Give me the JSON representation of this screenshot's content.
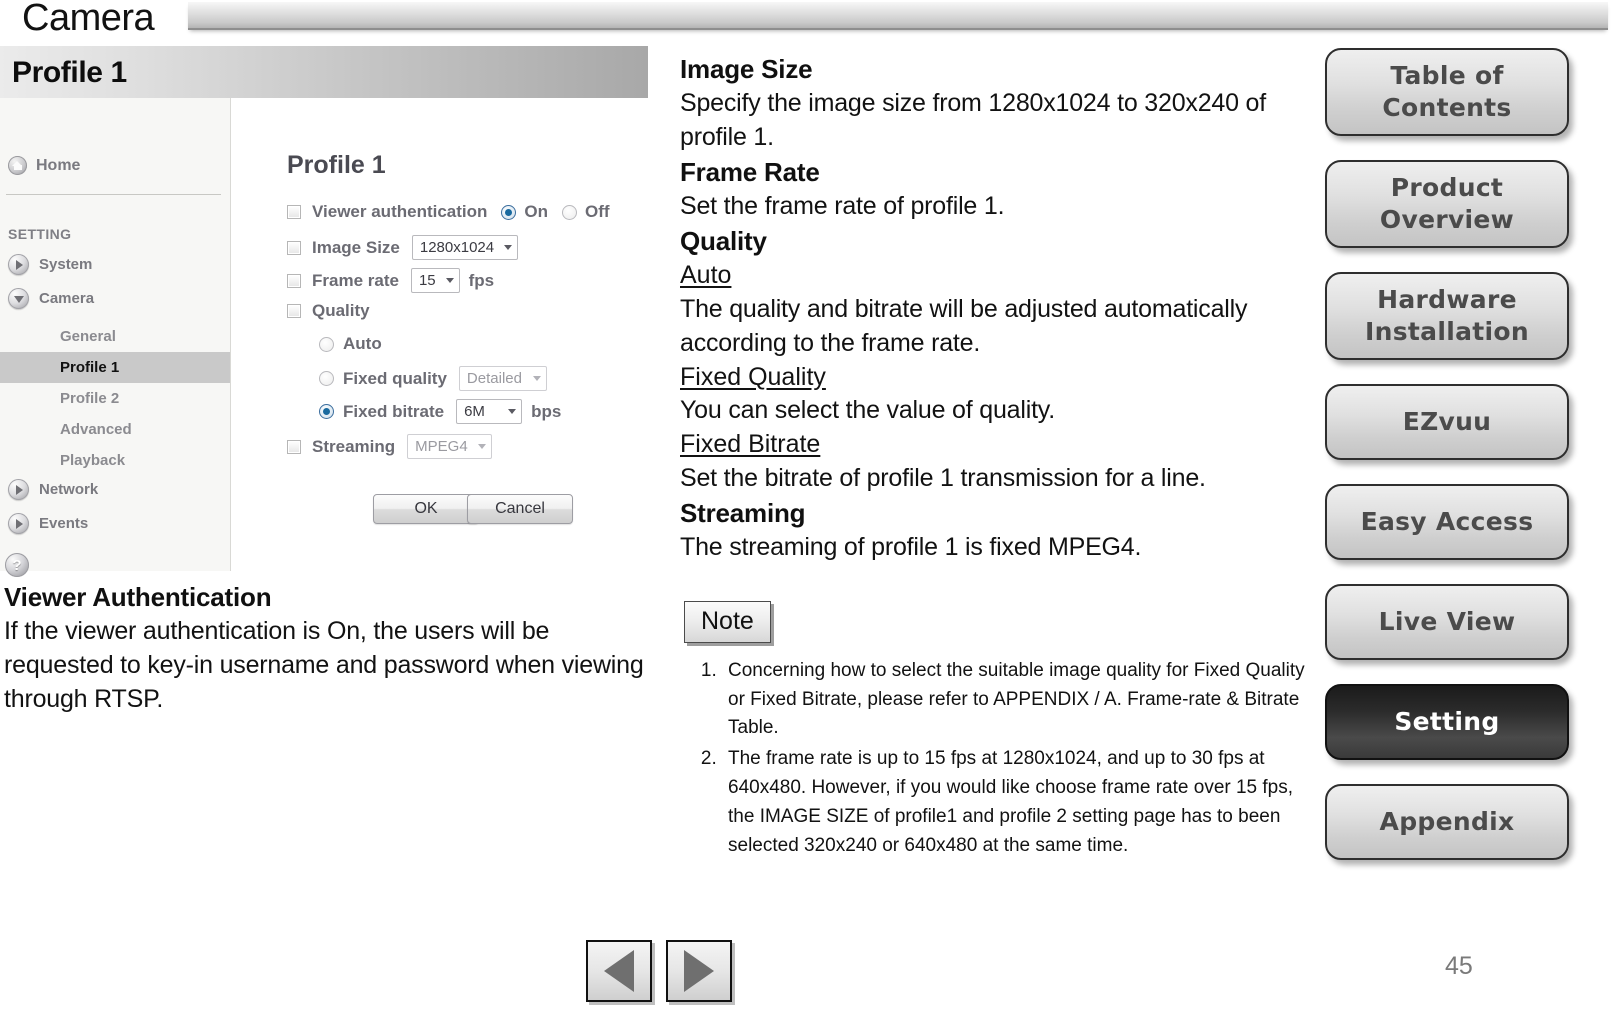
{
  "header": {
    "title": "Camera"
  },
  "camera_ui": {
    "titlebar": "Profile 1",
    "sidebar": {
      "home_label": "Home",
      "section_label": "SETTING",
      "groups": [
        {
          "label": "System",
          "state": "collapsed"
        },
        {
          "label": "Camera",
          "state": "expanded"
        }
      ],
      "camera_children": [
        {
          "label": "General",
          "active": false
        },
        {
          "label": "Profile 1",
          "active": true
        },
        {
          "label": "Profile 2",
          "active": false
        },
        {
          "label": "Advanced",
          "active": false
        },
        {
          "label": "Playback",
          "active": false
        }
      ],
      "groups_after": [
        {
          "label": "Network",
          "state": "collapsed"
        },
        {
          "label": "Events",
          "state": "collapsed"
        }
      ],
      "help_icon": "?"
    },
    "form": {
      "title": "Profile 1",
      "viewer_auth_label": "Viewer authentication",
      "viewer_auth_on": "On",
      "viewer_auth_off": "Off",
      "viewer_auth_value": "On",
      "image_size_label": "Image Size",
      "image_size_value": "1280x1024",
      "frame_rate_label": "Frame rate",
      "frame_rate_value": "15",
      "frame_rate_unit": "fps",
      "quality_label": "Quality",
      "quality_auto_label": "Auto",
      "quality_fixed_quality_label": "Fixed quality",
      "quality_fixed_quality_value": "Detailed",
      "quality_fixed_bitrate_label": "Fixed bitrate",
      "quality_fixed_bitrate_value": "6M",
      "bitrate_unit": "bps",
      "quality_selected": "Fixed bitrate",
      "streaming_label": "Streaming",
      "streaming_value": "MPEG4",
      "ok_label": "OK",
      "cancel_label": "Cancel"
    }
  },
  "left_body": {
    "heading": "Viewer Authentication",
    "paragraph": "If the viewer authentication is On, the users will be requested to key-in username and password when viewing through RTSP."
  },
  "right_doc": {
    "blocks": [
      {
        "style": "h",
        "text": "Image Size"
      },
      {
        "style": "p",
        "text": "Specify the image size from 1280x1024 to 320x240 of profile 1."
      },
      {
        "style": "h",
        "text": "Frame Rate"
      },
      {
        "style": "p",
        "text": "Set the frame rate of profile 1."
      },
      {
        "style": "h",
        "text": "Quality"
      },
      {
        "style": "u",
        "text": "Auto"
      },
      {
        "style": "p",
        "text": "The quality and bitrate will be adjusted automatically according to the frame rate."
      },
      {
        "style": "u",
        "text": "Fixed Quality"
      },
      {
        "style": "p",
        "text": "You can select the value of quality."
      },
      {
        "style": "u",
        "text": "Fixed Bitrate"
      },
      {
        "style": "p",
        "text": "Set the bitrate of profile 1  transmission for a line."
      },
      {
        "style": "h",
        "text": "Streaming"
      },
      {
        "style": "p",
        "text": "The streaming of profile 1 is fixed MPEG4."
      }
    ],
    "note_label": "Note",
    "note_items": [
      "Concerning how to select the suitable image quality for Fixed Quality or Fixed Bitrate, please refer to APPENDIX / A. Frame-rate & Bitrate Table.",
      "The frame rate is up to 15 fps at 1280x1024, and up to 30 fps at 640x480. However, if you would like choose frame rate over 15 fps, the IMAGE SIZE of profile1 and profile 2 setting page has to been selected 320x240 or 640x480 at the same time."
    ]
  },
  "side_nav": {
    "items": [
      {
        "label": "Table of Contents",
        "active": false
      },
      {
        "label": "Product Overview",
        "active": false
      },
      {
        "label": "Hardware Installation",
        "active": false
      },
      {
        "label": "EZvuu",
        "active": false
      },
      {
        "label": "Easy Access",
        "active": false
      },
      {
        "label": "Live View",
        "active": false
      },
      {
        "label": "Setting",
        "active": true
      },
      {
        "label": "Appendix",
        "active": false
      }
    ]
  },
  "footer": {
    "prev_label": "previous-page",
    "next_label": "next-page",
    "page_number": "45"
  }
}
